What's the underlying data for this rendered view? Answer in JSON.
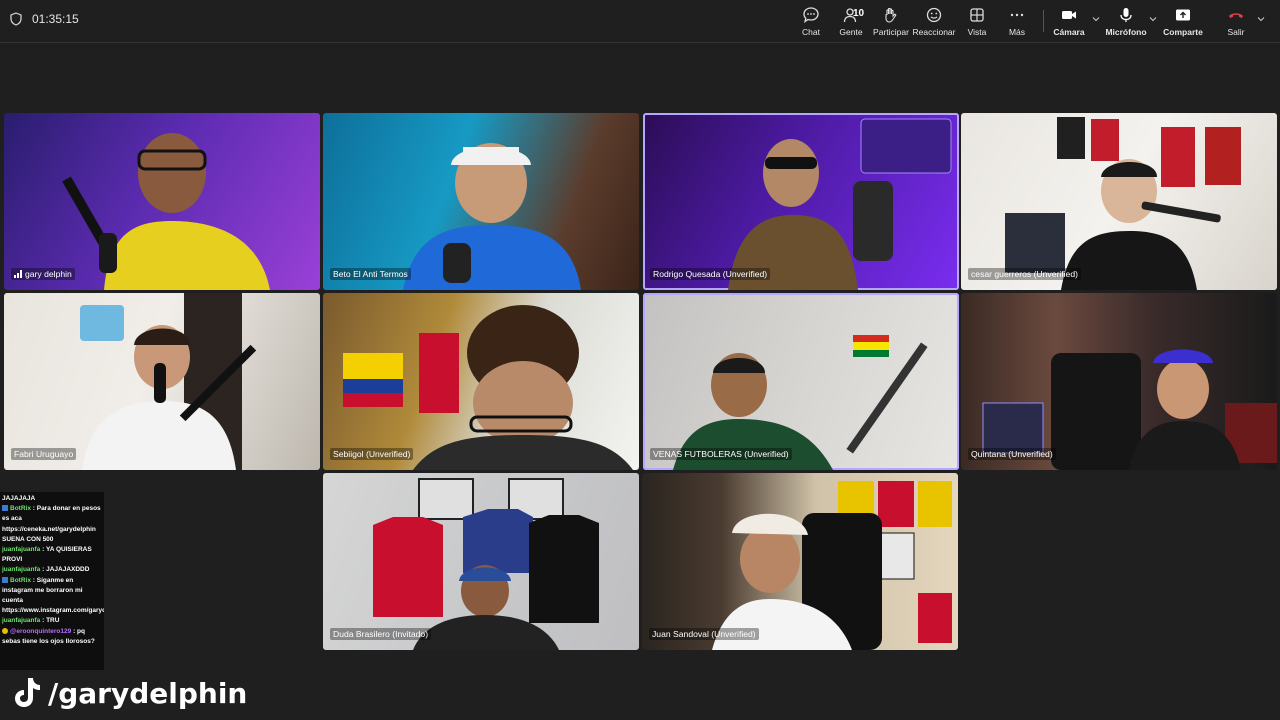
{
  "header": {
    "timer": "01:35:15",
    "people_count": "10",
    "buttons": {
      "chat": "Chat",
      "people": "Gente",
      "raise": "Participar",
      "react": "Reaccionar",
      "view": "Vista",
      "more": "Más",
      "camera": "Cámara",
      "mic": "Micrófono",
      "share": "Comparte",
      "leave": "Salir"
    }
  },
  "participants": [
    {
      "name": "gary delphin"
    },
    {
      "name": "Beto El Anti Termos"
    },
    {
      "name": "Rodrigo Quesada (Unverified)"
    },
    {
      "name": "cesar guerreros (Unverified)"
    },
    {
      "name": "Fabri Uruguayo"
    },
    {
      "name": "Sebiigol (Unverified)"
    },
    {
      "name": "VENAS FUTBOLERAS (Unverified)"
    },
    {
      "name": "Quintana (Unverified)"
    },
    {
      "name": "Duda Brasilero (Invitado)"
    },
    {
      "name": "Juan Sandoval (Unverified)"
    }
  ],
  "chat": {
    "lines": [
      {
        "user": "",
        "text": "JAJAJAJA"
      },
      {
        "user": "BotRix",
        "text": ": Para donar en pesos es aca https://cenekа.net/garydelphin SUENA CON 500"
      },
      {
        "user": "juanfajuanfa",
        "text": ": YA QUISIERAS PROVI"
      },
      {
        "user": "juanfajuanfa",
        "text": ": JAJAJAXDDD"
      },
      {
        "user": "BotRix",
        "text": ": Síganme en instagram me borraron mi cuenta https://www.instagram.com/garydelphinfutbol"
      },
      {
        "user": "juanfajuanfa",
        "text": ": TRU"
      },
      {
        "user": "@eroonquintero129",
        "text": ": pq sebas tiene los ojos llorosos?"
      }
    ]
  },
  "watermark": "/garydelphin",
  "colors": {
    "background": "#1f1f1f",
    "active_speaker_outline": "#b7a6ff",
    "leave_red": "#e0424b"
  }
}
